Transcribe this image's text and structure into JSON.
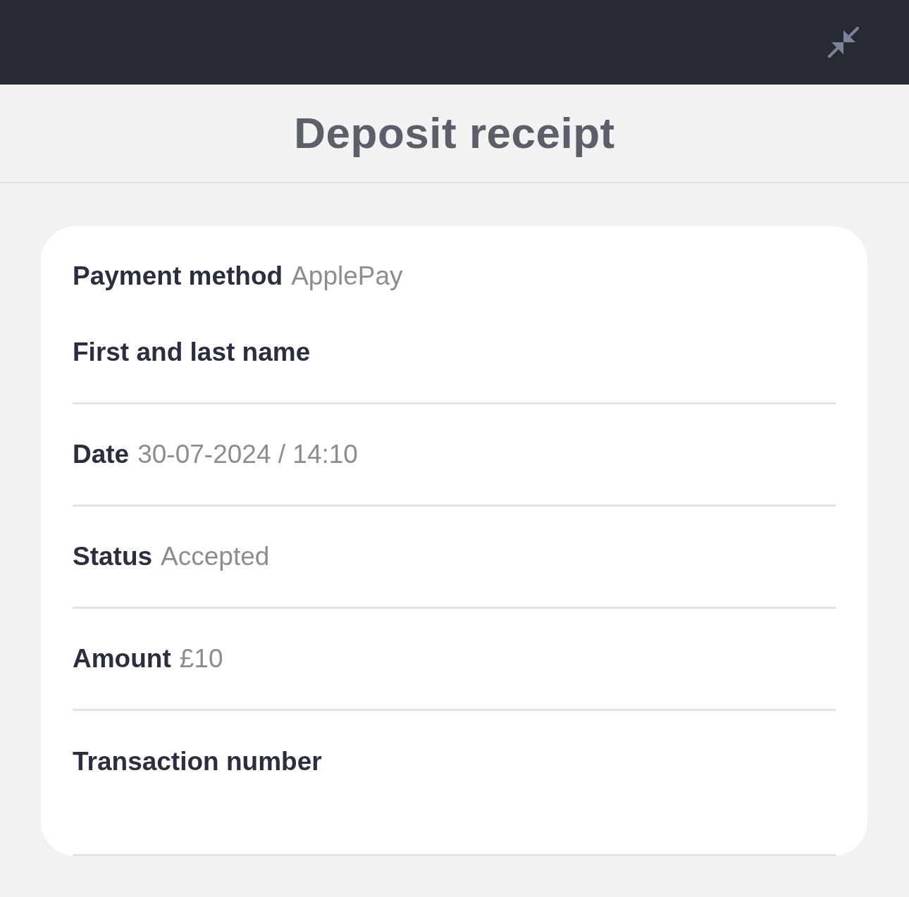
{
  "title": "Deposit receipt",
  "receipt": {
    "sections": [
      {
        "fields": [
          {
            "label": "Payment method",
            "value": "ApplePay"
          },
          {
            "label": "First and last name"
          }
        ]
      },
      {
        "fields": [
          {
            "label": "Date",
            "value": "30-07-2024 / 14:10"
          }
        ]
      },
      {
        "fields": [
          {
            "label": "Status",
            "value": "Accepted"
          }
        ]
      },
      {
        "fields": [
          {
            "label": "Amount",
            "value": "£10"
          }
        ]
      },
      {
        "fields": [
          {
            "label": "Transaction number"
          }
        ]
      }
    ]
  }
}
